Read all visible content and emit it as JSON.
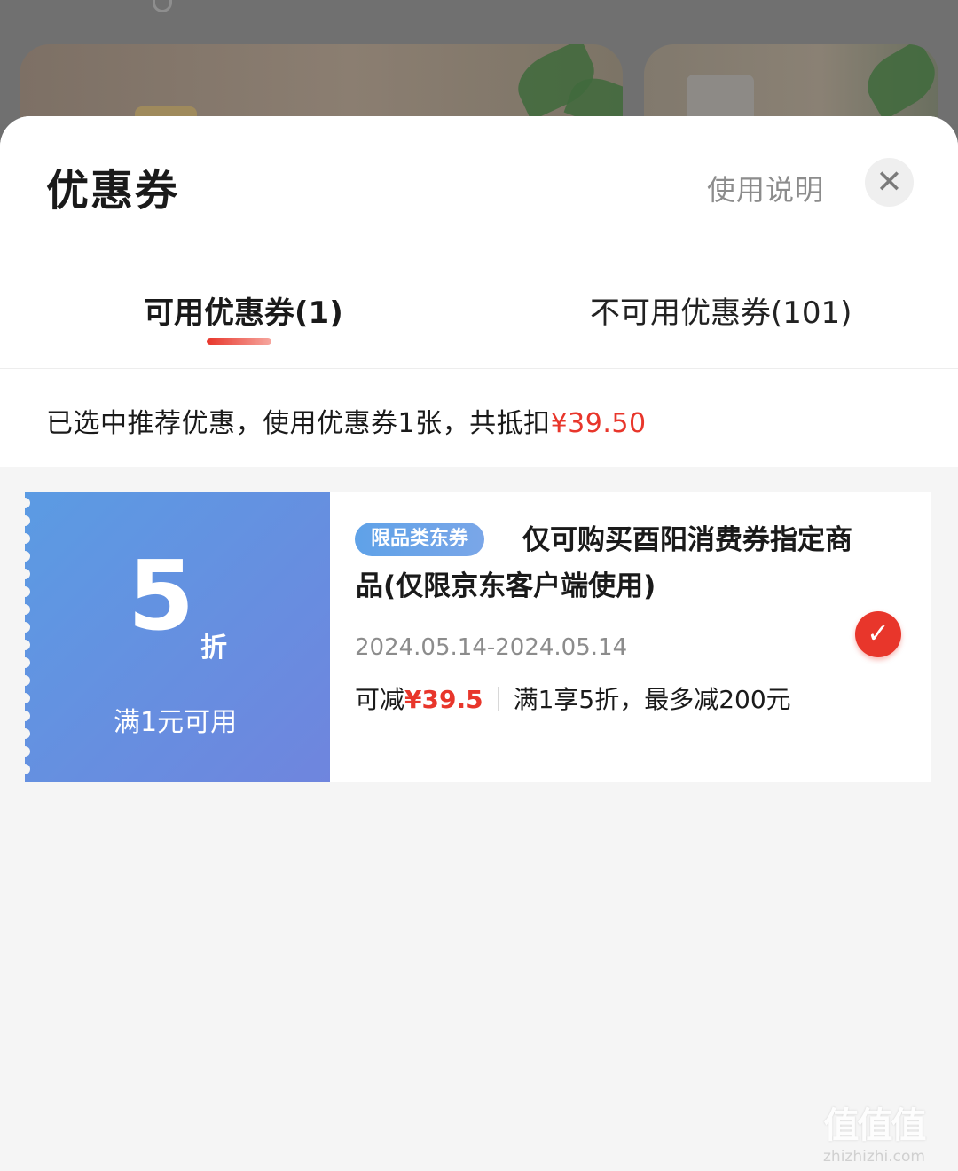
{
  "sheet": {
    "title": "优惠券",
    "help_label": "使用说明",
    "close_icon": "close-icon"
  },
  "tabs": [
    {
      "label": "可用优惠券(1)",
      "active": true
    },
    {
      "label": "不可用优惠券(101)",
      "active": false
    }
  ],
  "summary": {
    "text": "已选中推荐优惠，使用优惠券1张，共抵扣",
    "amount": "¥39.50"
  },
  "coupon": {
    "discount_value": "5",
    "discount_unit": "折",
    "threshold": "满1元可用",
    "tag": "限品类东券",
    "description": "仅可购买酉阳消费券指定商品(仅限京东客户端使用)",
    "validity": "2024.05.14-2024.05.14",
    "reduce_label": "可减",
    "reduce_amount": "¥39.5",
    "rule": "满1享5折，最多减200元",
    "selected": true
  },
  "watermark": {
    "logo": "值值值",
    "url": "zhizhizhi.com"
  },
  "colors": {
    "accent_red": "#e8362b",
    "coupon_blue": "#5b9be3"
  }
}
